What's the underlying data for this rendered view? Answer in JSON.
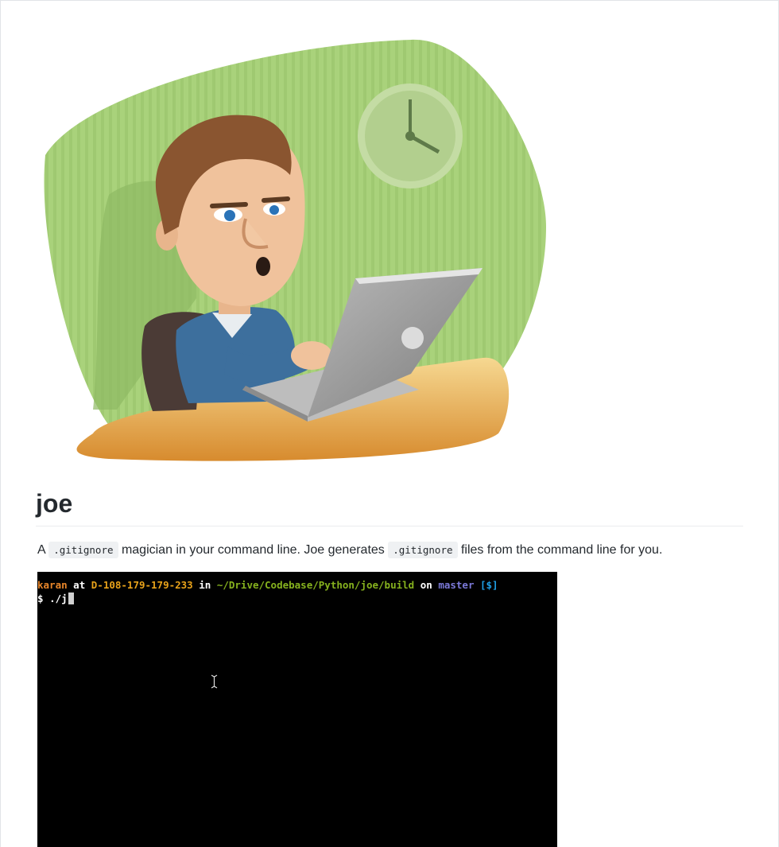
{
  "readme": {
    "hero_image": "cartoon developer typing on laptop",
    "title": "joe",
    "description": {
      "part1": "A ",
      "code1": ".gitignore",
      "part2": " magician in your command line. Joe generates ",
      "code2": ".gitignore",
      "part3": " files from the command line for you."
    }
  },
  "terminal": {
    "user": "karan",
    "at": "at",
    "host": "D-108-179-179-233",
    "in": "in",
    "path": "~/Drive/Codebase/Python/joe/build",
    "on": "on",
    "branch": "master",
    "status": "[$]",
    "prompt": "$",
    "command": "./j"
  },
  "colors": {
    "terminal_bg": "#000000",
    "user": "#e8862a",
    "host": "#e8a21a",
    "path": "#86b21e",
    "branch": "#7b79d9",
    "status": "#1fa0e6"
  }
}
